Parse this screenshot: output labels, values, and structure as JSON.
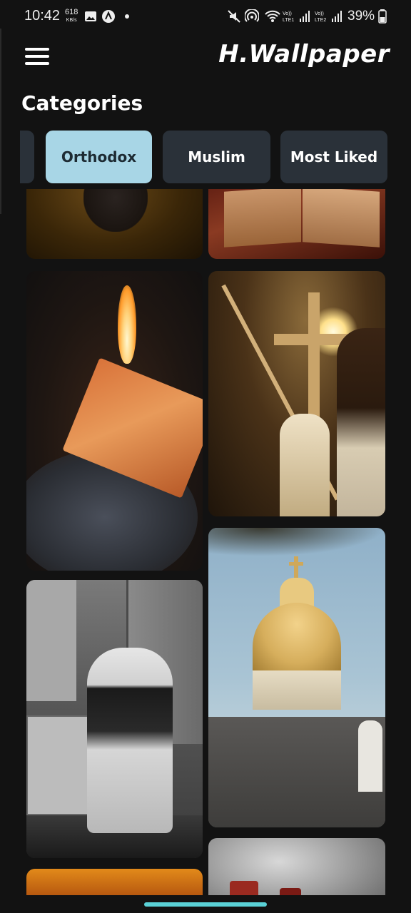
{
  "status_bar": {
    "time": "10:42",
    "net_speed_value": "618",
    "net_speed_unit": "KB/s",
    "battery_percent": "39%",
    "icons": [
      "gallery-icon",
      "app-a-icon",
      "dot-icon",
      "mute-icon",
      "hotspot-icon",
      "wifi-icon",
      "volte1-signal-icon",
      "volte2-signal-icon",
      "battery-icon"
    ]
  },
  "app_bar": {
    "title": "H.Wallpaper",
    "menu_icon": "hamburger-menu-icon"
  },
  "section": {
    "title": "Categories"
  },
  "categories": [
    {
      "label": "",
      "active": false
    },
    {
      "label": "Orthodox",
      "active": true
    },
    {
      "label": "Muslim",
      "active": false
    },
    {
      "label": "Most Liked",
      "active": false
    }
  ],
  "colors": {
    "background": "#121212",
    "chip_bg": "#2a3139",
    "chip_active_bg": "#a8d6e6",
    "chip_active_text": "#1d2b33",
    "nav_handle": "#5ad1d6"
  }
}
